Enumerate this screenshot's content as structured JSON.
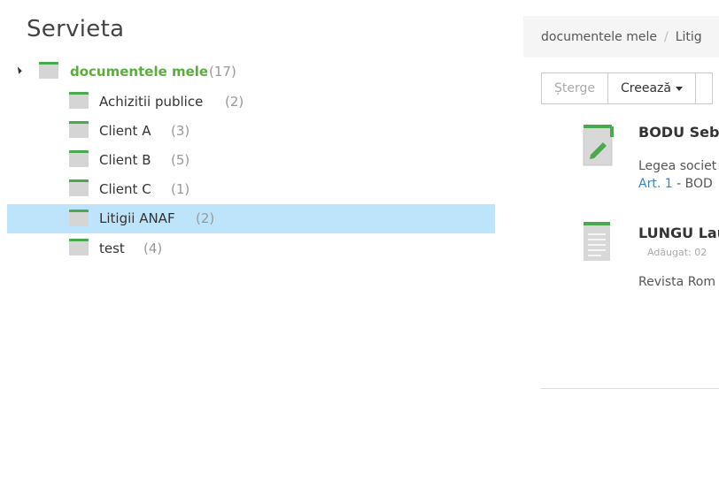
{
  "page": {
    "title": "Servieta"
  },
  "tree": {
    "root": {
      "label": "documentele mele",
      "count": "(17)"
    },
    "items": [
      {
        "label": "Achizitii publice",
        "count": "(2)"
      },
      {
        "label": "Client A",
        "count": "(3)"
      },
      {
        "label": "Client B",
        "count": "(5)"
      },
      {
        "label": "Client C",
        "count": "(1)"
      },
      {
        "label": "Litigii ANAF",
        "count": "(2)"
      },
      {
        "label": "test",
        "count": "(4)"
      }
    ]
  },
  "breadcrumb": {
    "root": "documentele mele",
    "separator": "/",
    "current": "Litig"
  },
  "toolbar": {
    "delete_label": "Șterge",
    "create_label": "Creează"
  },
  "documents": [
    {
      "title": "BODU Seba",
      "line1": "Legea societ",
      "link": "Art. 1",
      "line2_rest": " - BOD"
    },
    {
      "title": "LUNGU Lau",
      "meta": "Adăugat: 02",
      "line1": "Revista Rom"
    }
  ],
  "colors": {
    "accent_green": "#5aad3c",
    "selected_bg": "#bde4fa",
    "link_blue": "#3a82c4"
  }
}
